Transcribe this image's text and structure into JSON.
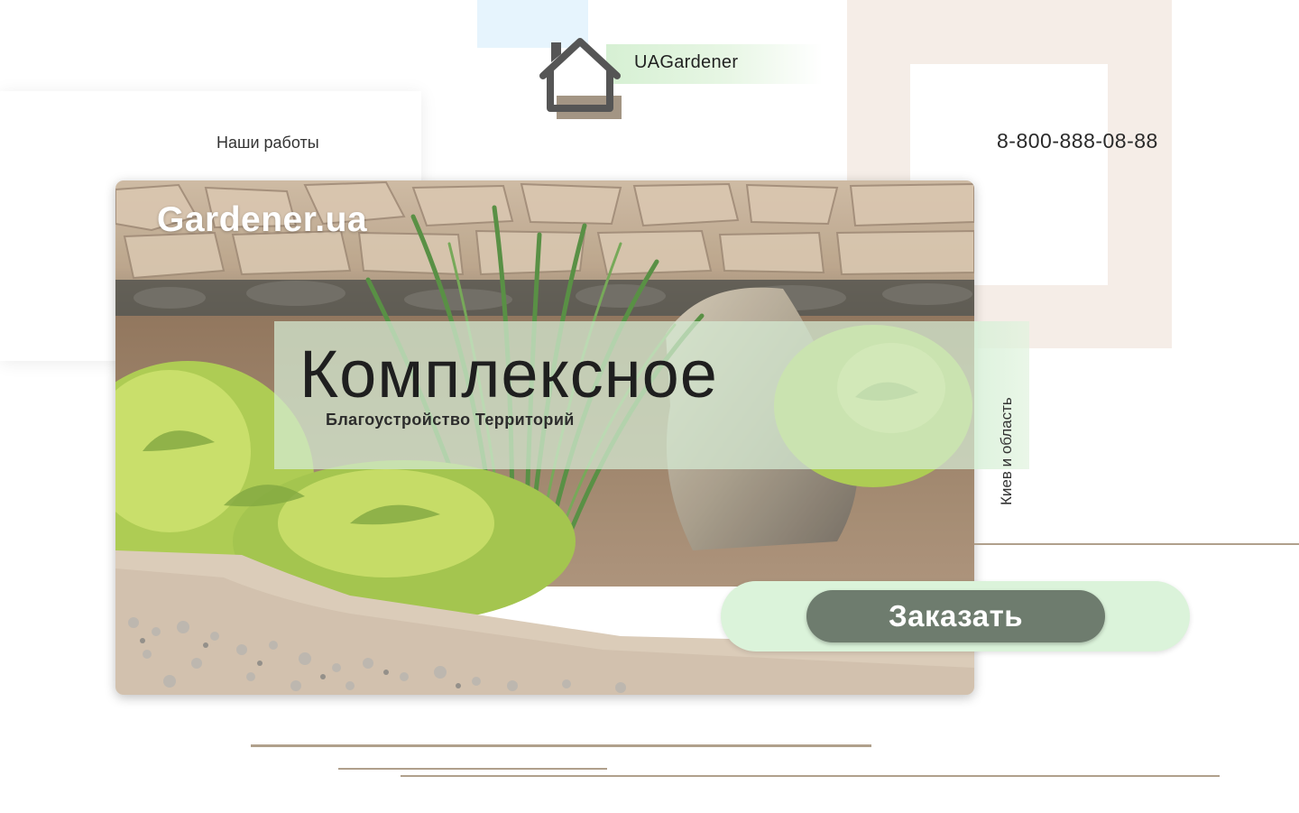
{
  "logo": {
    "text": "UAGardener",
    "icon": "house-icon"
  },
  "nav": {
    "works_label": "Наши работы"
  },
  "contact": {
    "phone": "8-800-888-08-88"
  },
  "hero": {
    "brand": "Gardener.ua",
    "title": "Комплексное",
    "subtitle": "Благоустройство Территорий",
    "region": "Киев и область"
  },
  "cta": {
    "order_label": "Заказать"
  },
  "colors": {
    "accent_green": "#dbf3da",
    "button": "#6e7c6e",
    "beige": "#f5ede7",
    "line": "#b0a08c"
  }
}
